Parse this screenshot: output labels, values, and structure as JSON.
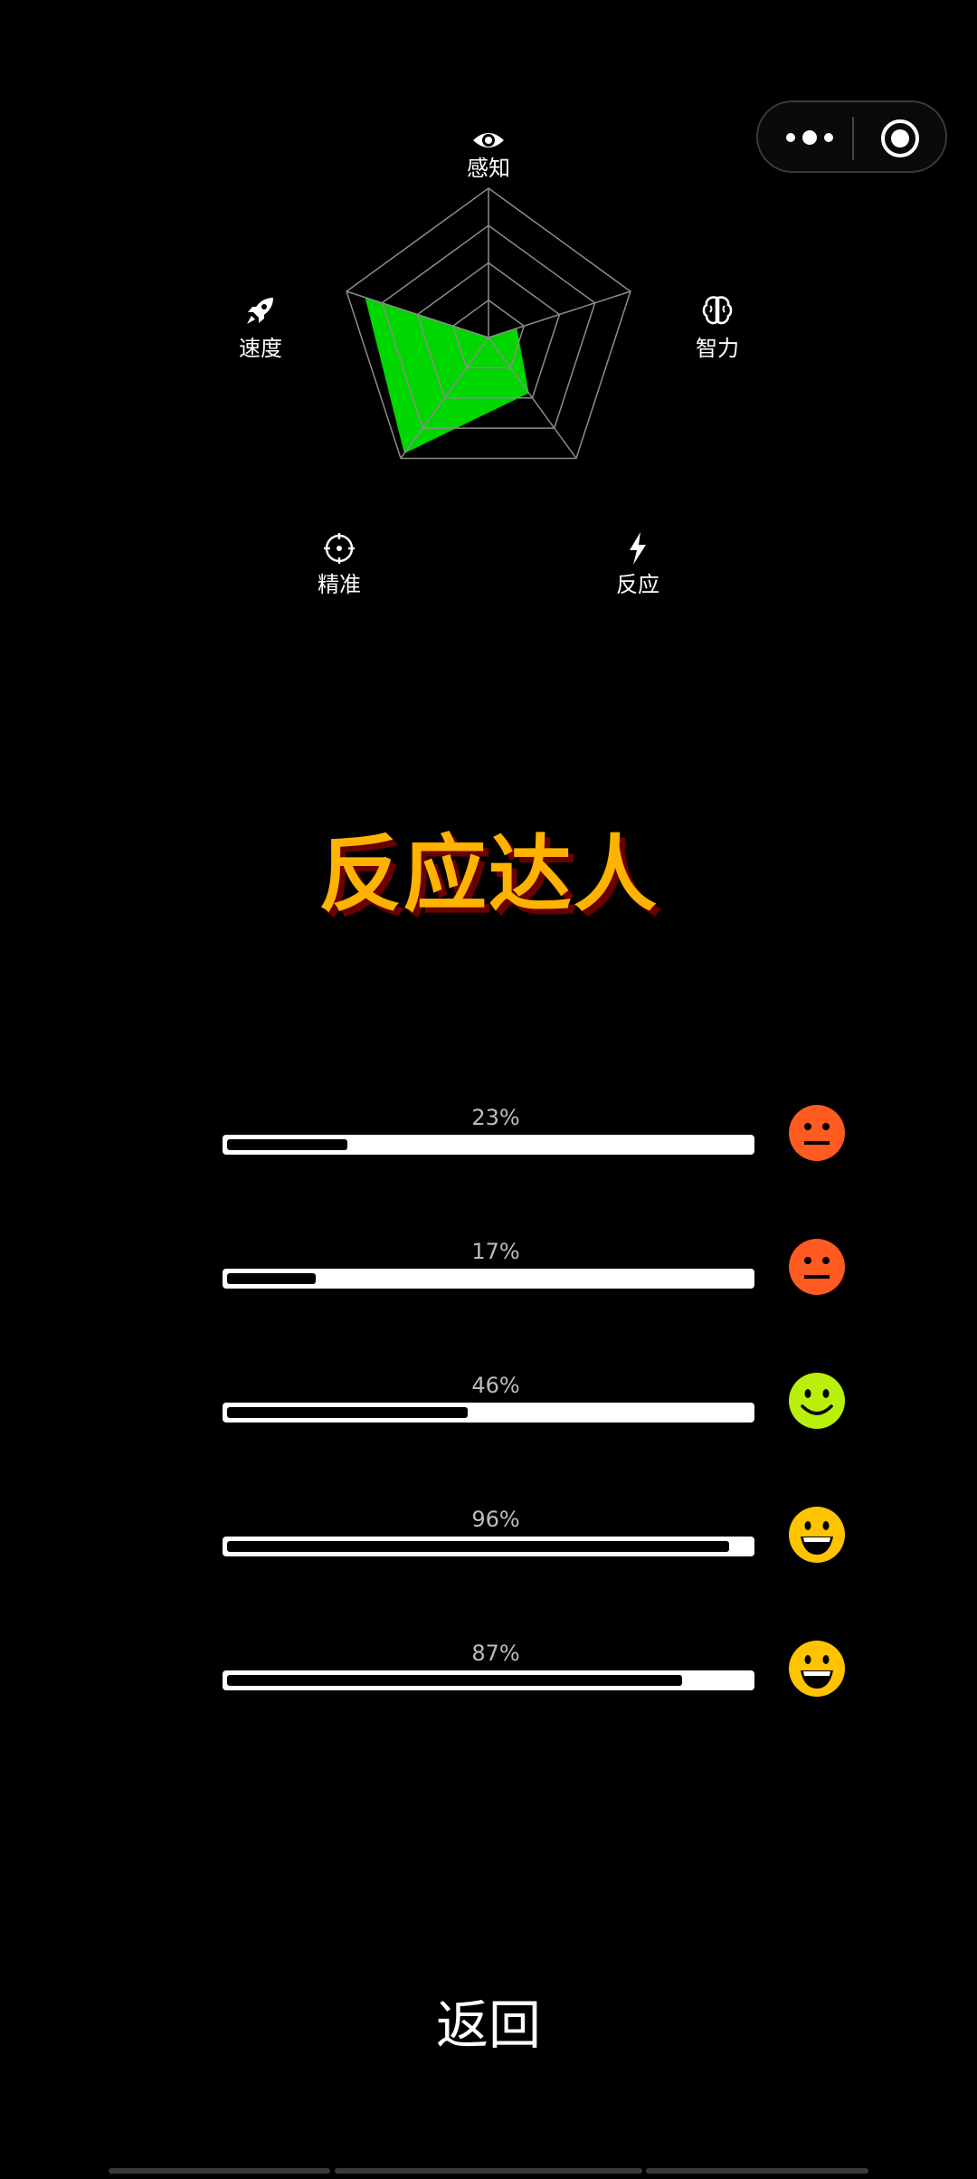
{
  "capsule": {
    "more_icon": "more-dots-icon",
    "close_icon": "target-close-icon"
  },
  "radar": {
    "axes": [
      {
        "label": "感知",
        "icon": "eye-icon",
        "value": 0.0
      },
      {
        "label": "智力",
        "icon": "brain-icon",
        "value": 0.2
      },
      {
        "label": "反应",
        "icon": "lightning-icon",
        "value": 0.46
      },
      {
        "label": "精准",
        "icon": "crosshair-icon",
        "value": 0.96
      },
      {
        "label": "速度",
        "icon": "rocket-icon",
        "value": 0.87
      }
    ],
    "grid_color": "#8c8c8c",
    "fill_color": "#00d600",
    "rings": 4
  },
  "title": "反应达人",
  "rows": [
    {
      "percent_text": "23%",
      "value": 0.23,
      "face": "neutral-face-icon",
      "face_color": "#ff5a1f"
    },
    {
      "percent_text": "17%",
      "value": 0.17,
      "face": "neutral-face-icon",
      "face_color": "#ff5a1f"
    },
    {
      "percent_text": "46%",
      "value": 0.46,
      "face": "smile-face-icon",
      "face_color": "#b8f00c"
    },
    {
      "percent_text": "96%",
      "value": 0.96,
      "face": "grin-face-icon",
      "face_color": "#ffc300"
    },
    {
      "percent_text": "87%",
      "value": 0.87,
      "face": "grin-face-icon",
      "face_color": "#ffc300"
    }
  ],
  "back_label": "返回"
}
